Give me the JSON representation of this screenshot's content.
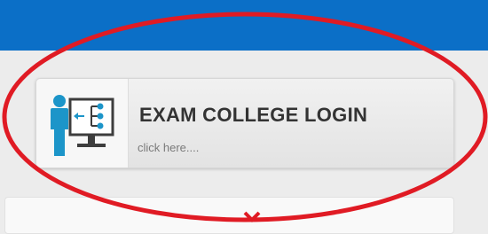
{
  "header": {
    "color": "#0b6fc7"
  },
  "login_card": {
    "title": "EXAM COLLEGE LOGIN",
    "subtitle": "click here....",
    "icon": "presentation-board-icon"
  },
  "colors": {
    "icon_primary": "#1c95c9",
    "icon_dark": "#3d3d3d",
    "annotation": "#e01b24"
  }
}
